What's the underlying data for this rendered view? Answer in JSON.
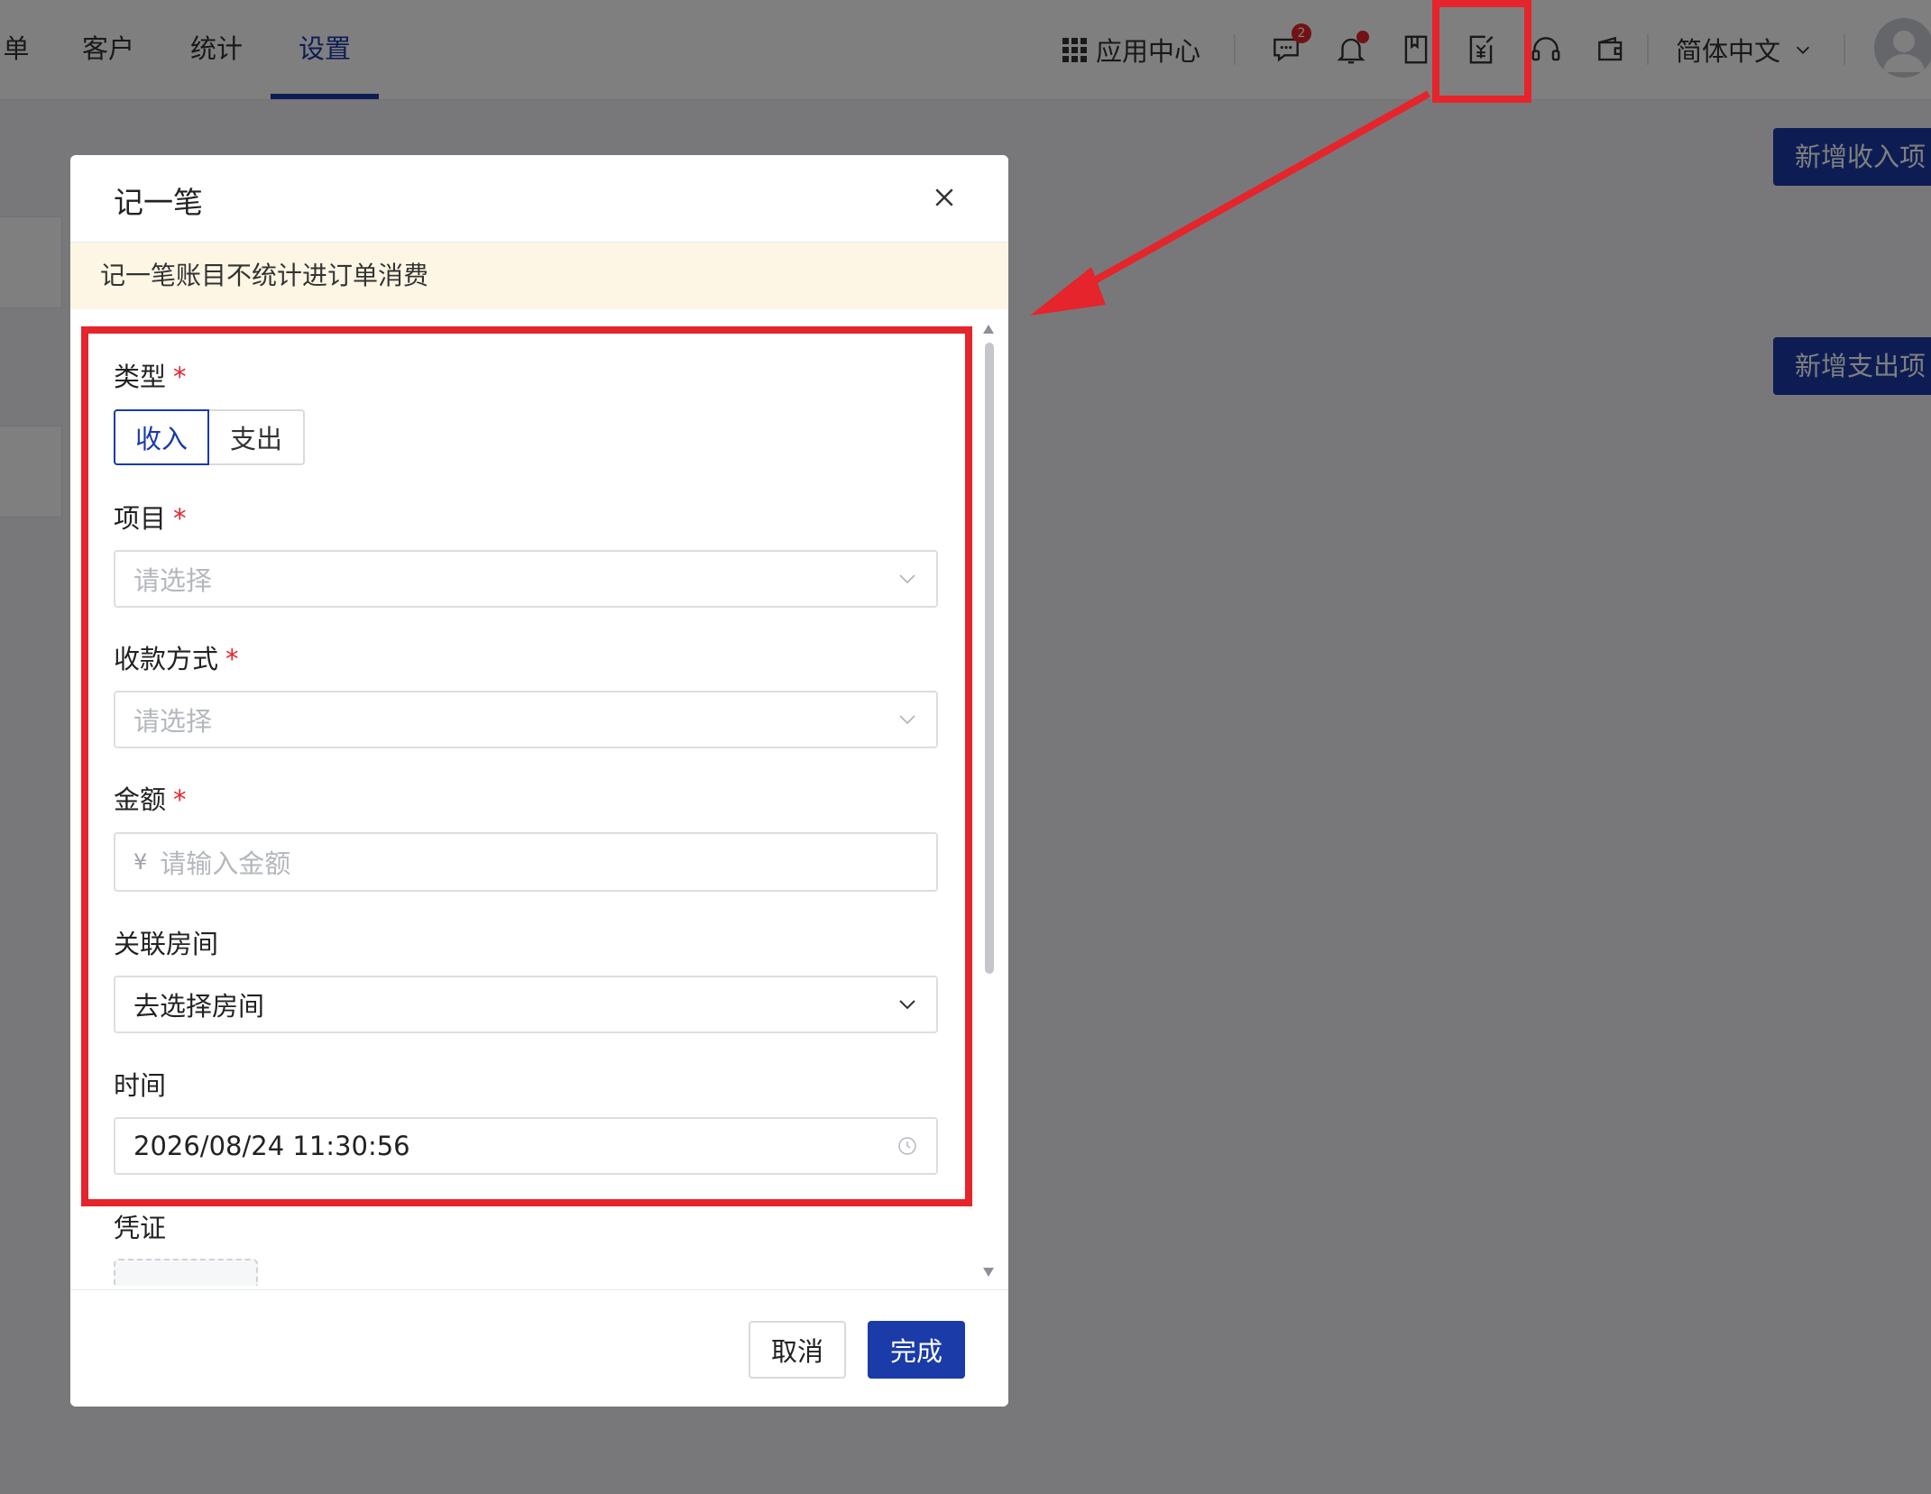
{
  "nav": {
    "tabs": [
      {
        "label": "单"
      },
      {
        "label": "客户"
      },
      {
        "label": "统计"
      },
      {
        "label": "设置",
        "active": true
      }
    ]
  },
  "header": {
    "app_center": "应用中心",
    "message_badge": "2",
    "language": "简体中文",
    "icons": [
      "message-icon",
      "bell-icon",
      "book-icon",
      "bookkeeping-icon",
      "headset-icon",
      "wallet-icon",
      "chevron-down-icon",
      "avatar"
    ]
  },
  "background": {
    "add_income_button": "新增收入项",
    "add_expense_button": "新增支出项"
  },
  "modal": {
    "title": "记一笔",
    "notice": "记一笔账目不统计进订单消费",
    "type": {
      "label": "类型",
      "options": [
        "收入",
        "支出"
      ],
      "selected": "收入"
    },
    "item": {
      "label": "项目",
      "placeholder": "请选择"
    },
    "payment_method": {
      "label": "收款方式",
      "placeholder": "请选择"
    },
    "amount": {
      "label": "金额",
      "currency": "¥",
      "placeholder": "请输入金额"
    },
    "room": {
      "label": "关联房间",
      "value": "去选择房间"
    },
    "time": {
      "label": "时间",
      "value": "2026/08/24 11:30:56"
    },
    "voucher": {
      "label": "凭证"
    },
    "required_mark": "*",
    "cancel_button": "取消",
    "confirm_button": "完成"
  },
  "colors": {
    "accent": "#1a3ba8",
    "annotation_red": "#e5242b",
    "notice_bg": "#fdf6e4"
  }
}
